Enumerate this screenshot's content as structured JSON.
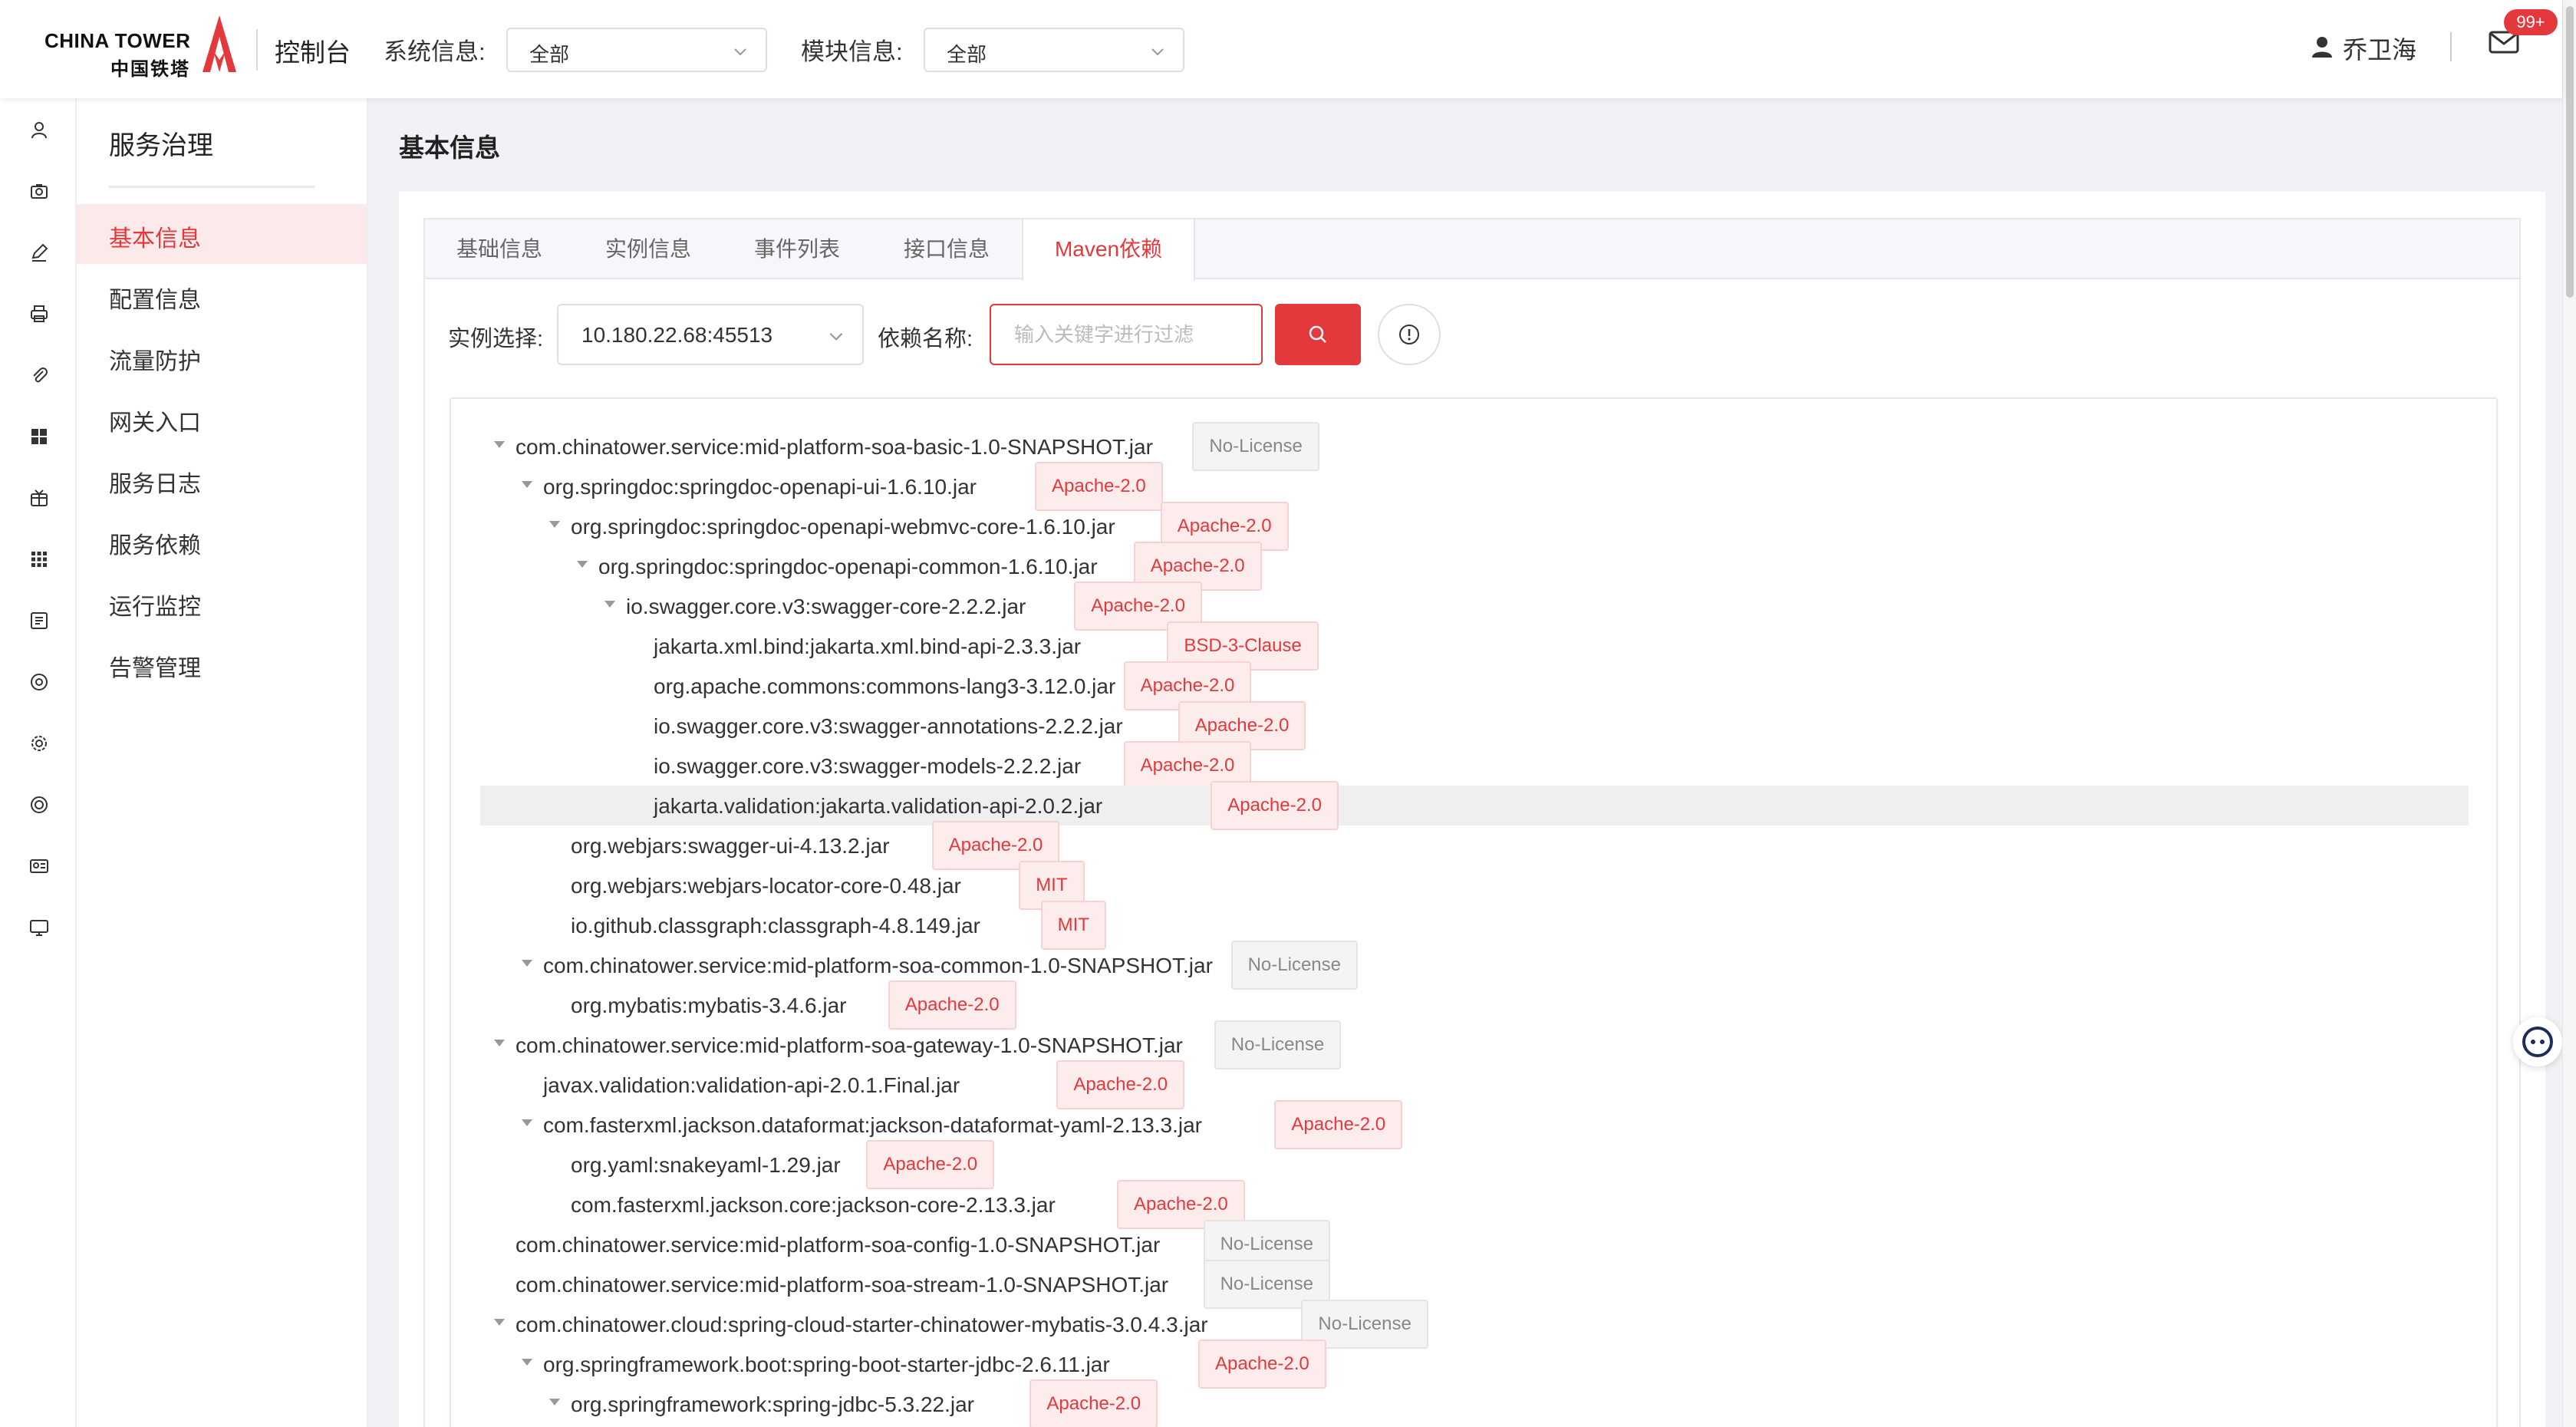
{
  "header": {
    "logo_en": "CHINA TOWER",
    "logo_cn": "中国铁塔",
    "console": "控制台",
    "system_label": "系统信息:",
    "system_value": "全部",
    "module_label": "模块信息:",
    "module_value": "全部",
    "user_name": "乔卫海",
    "mail_badge": "99+"
  },
  "sidebar": {
    "title": "服务治理",
    "items": [
      {
        "label": "基本信息",
        "active": true
      },
      {
        "label": "配置信息"
      },
      {
        "label": "流量防护"
      },
      {
        "label": "网关入口"
      },
      {
        "label": "服务日志"
      },
      {
        "label": "服务依赖"
      },
      {
        "label": "运行监控"
      },
      {
        "label": "告警管理"
      }
    ]
  },
  "main": {
    "page_title": "基本信息",
    "tabs": [
      "基础信息",
      "实例信息",
      "事件列表",
      "接口信息",
      "Maven依赖"
    ],
    "active_tab": "Maven依赖",
    "instance_label": "实例选择:",
    "instance_value": "10.180.22.68:45513",
    "dep_label": "依赖名称:",
    "dep_placeholder": "输入关键字进行过滤"
  },
  "tree": [
    {
      "label": "com.chinatower.service:mid-platform-soa-basic-1.0-SNAPSHOT.jar",
      "license": "No-License",
      "depth": 0,
      "expanded": true
    },
    {
      "label": "org.springdoc:springdoc-openapi-ui-1.6.10.jar",
      "license": "Apache-2.0",
      "depth": 1,
      "expanded": true
    },
    {
      "label": "org.springdoc:springdoc-openapi-webmvc-core-1.6.10.jar",
      "license": "Apache-2.0",
      "depth": 2,
      "expanded": true
    },
    {
      "label": "org.springdoc:springdoc-openapi-common-1.6.10.jar",
      "license": "Apache-2.0",
      "depth": 3,
      "expanded": true
    },
    {
      "label": "io.swagger.core.v3:swagger-core-2.2.2.jar",
      "license": "Apache-2.0",
      "depth": 4,
      "expanded": true
    },
    {
      "label": "jakarta.xml.bind:jakarta.xml.bind-api-2.3.3.jar",
      "license": "BSD-3-Clause",
      "depth": 5
    },
    {
      "label": "org.apache.commons:commons-lang3-3.12.0.jar",
      "license": "Apache-2.0",
      "depth": 5
    },
    {
      "label": "io.swagger.core.v3:swagger-annotations-2.2.2.jar",
      "license": "Apache-2.0",
      "depth": 5
    },
    {
      "label": "io.swagger.core.v3:swagger-models-2.2.2.jar",
      "license": "Apache-2.0",
      "depth": 5
    },
    {
      "label": "jakarta.validation:jakarta.validation-api-2.0.2.jar",
      "license": "Apache-2.0",
      "depth": 5,
      "highlight": true
    },
    {
      "label": "org.webjars:swagger-ui-4.13.2.jar",
      "license": "Apache-2.0",
      "depth": 2
    },
    {
      "label": "org.webjars:webjars-locator-core-0.48.jar",
      "license": "MIT",
      "depth": 2
    },
    {
      "label": "io.github.classgraph:classgraph-4.8.149.jar",
      "license": "MIT",
      "depth": 2
    },
    {
      "label": "com.chinatower.service:mid-platform-soa-common-1.0-SNAPSHOT.jar",
      "license": "No-License",
      "depth": 1,
      "expanded": true
    },
    {
      "label": "org.mybatis:mybatis-3.4.6.jar",
      "license": "Apache-2.0",
      "depth": 2
    },
    {
      "label": "com.chinatower.service:mid-platform-soa-gateway-1.0-SNAPSHOT.jar",
      "license": "No-License",
      "depth": 0,
      "expanded": true
    },
    {
      "label": "javax.validation:validation-api-2.0.1.Final.jar",
      "license": "Apache-2.0",
      "depth": 1
    },
    {
      "label": "com.fasterxml.jackson.dataformat:jackson-dataformat-yaml-2.13.3.jar",
      "license": "Apache-2.0",
      "depth": 1,
      "expanded": true
    },
    {
      "label": "org.yaml:snakeyaml-1.29.jar",
      "license": "Apache-2.0",
      "depth": 2
    },
    {
      "label": "com.fasterxml.jackson.core:jackson-core-2.13.3.jar",
      "license": "Apache-2.0",
      "depth": 2
    },
    {
      "label": "com.chinatower.service:mid-platform-soa-config-1.0-SNAPSHOT.jar",
      "license": "No-License",
      "depth": 0
    },
    {
      "label": "com.chinatower.service:mid-platform-soa-stream-1.0-SNAPSHOT.jar",
      "license": "No-License",
      "depth": 0
    },
    {
      "label": "com.chinatower.cloud:spring-cloud-starter-chinatower-mybatis-3.0.4.3.jar",
      "license": "No-License",
      "depth": 0,
      "expanded": true
    },
    {
      "label": "org.springframework.boot:spring-boot-starter-jdbc-2.6.11.jar",
      "license": "Apache-2.0",
      "depth": 1,
      "expanded": true
    },
    {
      "label": "org.springframework:spring-jdbc-5.3.22.jar",
      "license": "Apache-2.0",
      "depth": 2,
      "expanded": true
    }
  ]
}
